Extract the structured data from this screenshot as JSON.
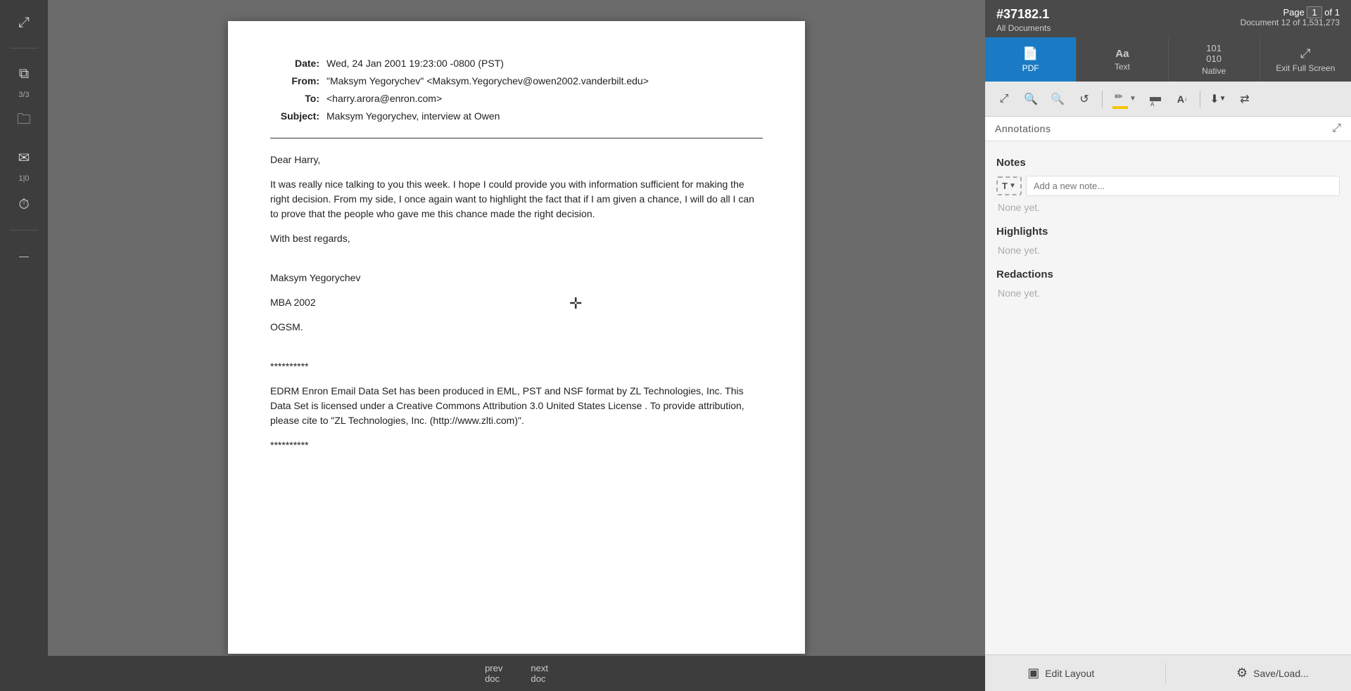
{
  "sidebar": {
    "icons": [
      {
        "name": "expand-icon",
        "symbol": "⤢",
        "label": ""
      },
      {
        "name": "copy-icon",
        "symbol": "⧉",
        "label": "3/3"
      },
      {
        "name": "folder-icon",
        "symbol": "🗁",
        "label": ""
      },
      {
        "name": "email-icon",
        "symbol": "✉",
        "label": "1|0"
      },
      {
        "name": "history-icon",
        "symbol": "🕐",
        "label": ""
      },
      {
        "name": "dash-icon",
        "symbol": "—",
        "label": ""
      }
    ]
  },
  "document": {
    "email": {
      "date_label": "Date:",
      "date_value": "Wed, 24 Jan 2001 19:23:00 -0800 (PST)",
      "from_label": "From:",
      "from_value": "\"Maksym Yegorychev\" <Maksym.Yegorychev@owen2002.vanderbilt.edu>",
      "to_label": "To:",
      "to_value": "<harry.arora@enron.com>",
      "subject_label": "Subject:",
      "subject_value": "Maksym Yegorychev, interview at Owen",
      "body_line1": "Dear Harry,",
      "body_para1": "It was really nice talking to you this week. I hope I could provide you with information sufficient for making the right decision. From my side, I once again want to highlight the fact that if I am given a chance, I will do all I can to prove that the people who gave me this chance made the right decision.",
      "body_line2": "With best regards,",
      "body_line3": "",
      "signature1": "Maksym Yegorychev",
      "signature2": "MBA 2002",
      "signature3": "OGSM.",
      "stars1": "**********",
      "footer_text": "EDRM Enron Email Data Set has been produced in EML, PST and NSF format by ZL Technologies, Inc. This Data Set is licensed under a Creative Commons Attribution 3.0 United States License . To provide attribution, please cite to \"ZL Technologies, Inc. (http://www.zlti.com)\".",
      "stars2": "**********"
    },
    "prev_label": "prev",
    "prev_sub": "doc",
    "next_label": "next",
    "next_sub": "doc"
  },
  "right_panel": {
    "doc_id": "#37182.1",
    "page_label": "Page",
    "page_current": "1",
    "page_sep": "of",
    "page_total": "1",
    "all_docs": "All Documents",
    "doc_count": "Document 12 of 1,531,273",
    "tabs": [
      {
        "name": "pdf-tab",
        "icon": "📄",
        "label": "PDF",
        "active": true
      },
      {
        "name": "text-tab",
        "icon": "Aa",
        "label": "Text",
        "active": false
      },
      {
        "name": "native-tab",
        "icon": "⊞",
        "label": "Native",
        "active": false
      },
      {
        "name": "fullscreen-tab",
        "icon": "⤢",
        "label": "Exit Full Screen",
        "active": false
      }
    ],
    "toolbar": {
      "fit_btn": "⤢",
      "zoom_in": "🔍",
      "zoom_out": "🔍",
      "rotate": "↺",
      "highlight_icon": "✏",
      "redact_icon": "▬",
      "text_icon": "A",
      "download_icon": "⬇",
      "share_icon": "⇄"
    },
    "annotations": {
      "title": "Annotations",
      "expand_icon": "⤢",
      "notes_section": "Notes",
      "note_placeholder": "Add a new note...",
      "notes_none": "None yet.",
      "highlights_section": "Highlights",
      "highlights_none": "None yet.",
      "redactions_section": "Redactions",
      "redactions_none": "None yet."
    },
    "bottom_bar": {
      "edit_layout_icon": "▣",
      "edit_layout_label": "Edit Layout",
      "save_load_icon": "⚙",
      "save_load_label": "Save/Load..."
    }
  }
}
